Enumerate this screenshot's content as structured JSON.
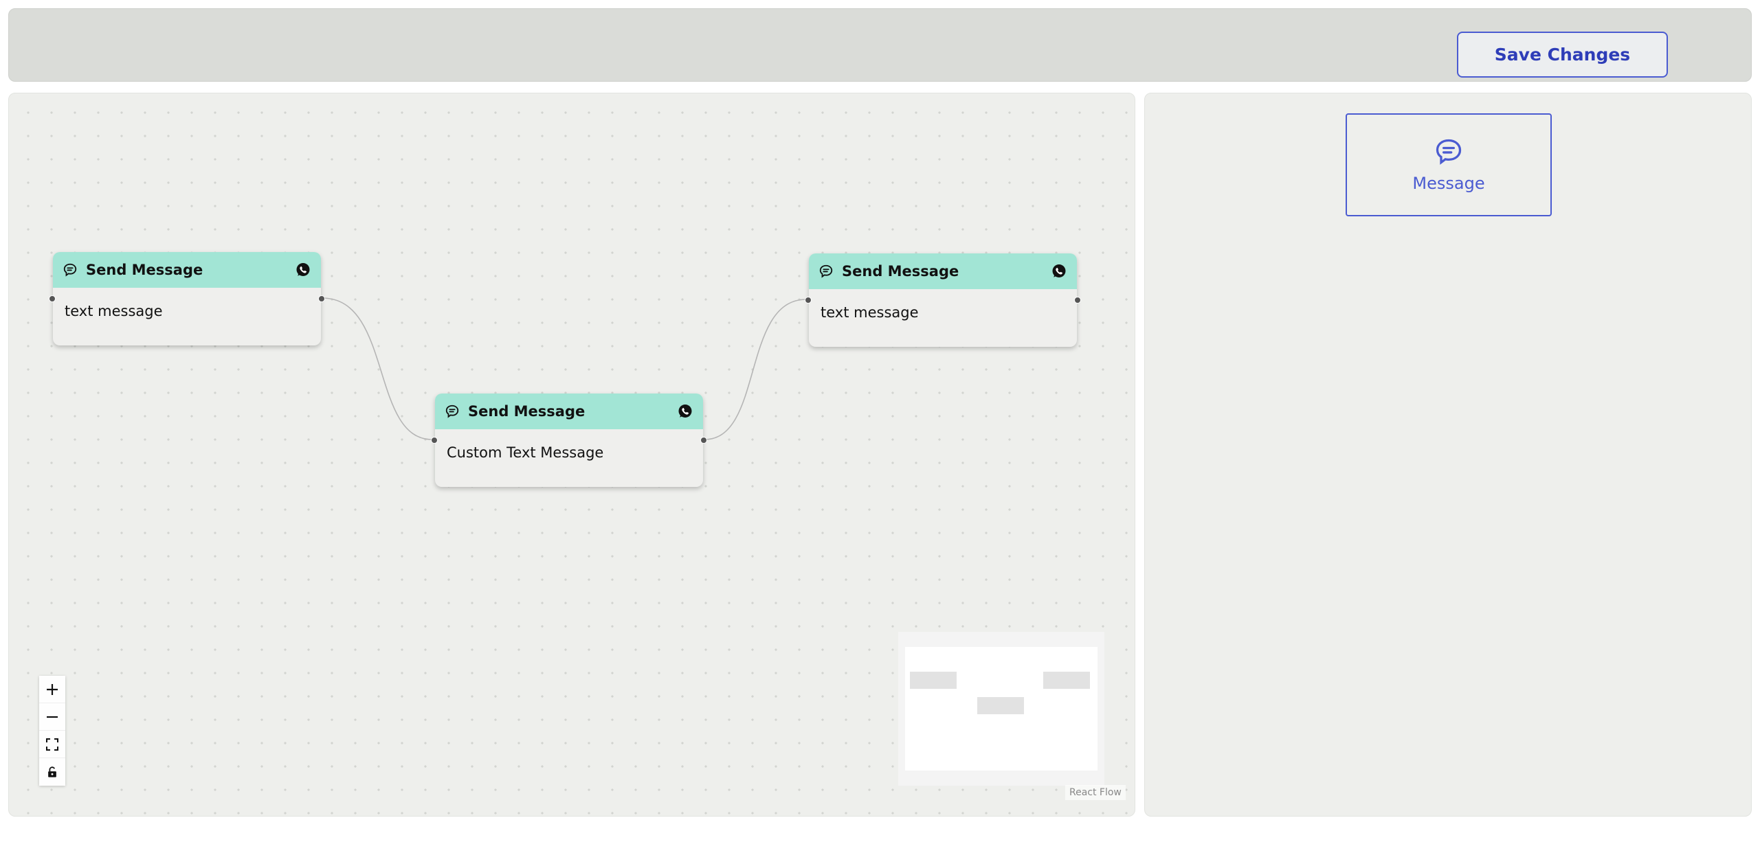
{
  "toolbar": {
    "save_label": "Save Changes"
  },
  "nodes": [
    {
      "title": "Send Message",
      "body": "text message"
    },
    {
      "title": "Send Message",
      "body": "Custom Text Message"
    },
    {
      "title": "Send Message",
      "body": "text message"
    }
  ],
  "sidebar": {
    "message_label": "Message"
  },
  "attribution": "React Flow",
  "colors": {
    "accent": "#4a5bd1",
    "node_header": "#a2e5d5",
    "canvas": "#eeefec",
    "topbar": "#dadcd8"
  },
  "icons": {
    "node_type": "chat-bubble-icon",
    "channel": "whatsapp-icon"
  }
}
